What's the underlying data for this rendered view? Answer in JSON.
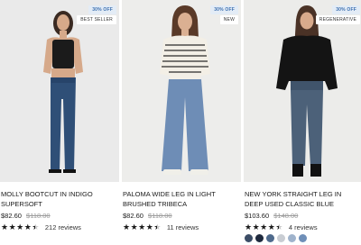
{
  "products": [
    {
      "discount_badge": "30% OFF",
      "tag_badge": "BEST SELLER",
      "name": "MOLLY BOOTCUT IN INDIGO SUPERSOFT",
      "price": "$82.60",
      "compare_price": "$118.00",
      "rating": 4.5,
      "reviews": "212 reviews",
      "image_icon": "model-photo"
    },
    {
      "discount_badge": "30% OFF",
      "tag_badge": "NEW",
      "name": "PALOMA WIDE LEG IN LIGHT BRUSHED TRIBECA",
      "price": "$82.60",
      "compare_price": "$118.00",
      "rating": 4.5,
      "reviews": "11 reviews",
      "image_icon": "model-photo"
    },
    {
      "discount_badge": "30% OFF",
      "tag_badge": "REGENERATIVE",
      "name": "NEW YORK STRAIGHT LEG IN DEEP USED CLASSIC BLUE",
      "price": "$103.60",
      "compare_price": "$148.00",
      "rating": 4.5,
      "reviews": "4 reviews",
      "image_icon": "model-photo",
      "swatches": [
        "#3c4d66",
        "#1f2a3e",
        "#4f6a8c",
        "#c9cdd3",
        "#9fb3cc",
        "#6f8fb8"
      ]
    }
  ]
}
